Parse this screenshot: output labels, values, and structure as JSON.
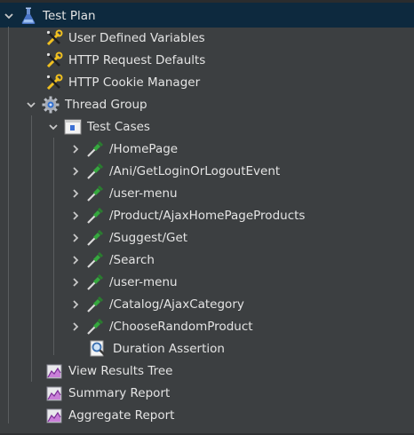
{
  "tree": {
    "root": {
      "label": "Test Plan",
      "icon": "flask-icon",
      "expanded": true,
      "selected": true
    },
    "config_elements": [
      {
        "label": "User Defined Variables",
        "icon": "wrench-screwdriver-icon"
      },
      {
        "label": "HTTP Request Defaults",
        "icon": "wrench-screwdriver-icon"
      },
      {
        "label": "HTTP Cookie Manager",
        "icon": "wrench-screwdriver-icon"
      }
    ],
    "thread_group": {
      "label": "Thread Group",
      "icon": "gear-icon",
      "expanded": true,
      "controller": {
        "label": "Test Cases",
        "icon": "simple-controller-icon",
        "expanded": true,
        "samplers": [
          {
            "label": "/HomePage",
            "icon": "pipette-icon"
          },
          {
            "label": "/Ani/GetLoginOrLogoutEvent",
            "icon": "pipette-icon"
          },
          {
            "label": "/user-menu",
            "icon": "pipette-icon"
          },
          {
            "label": "/Product/AjaxHomePageProducts",
            "icon": "pipette-icon"
          },
          {
            "label": "/Suggest/Get",
            "icon": "pipette-icon"
          },
          {
            "label": "/Search",
            "icon": "pipette-icon"
          },
          {
            "label": "/user-menu",
            "icon": "pipette-icon"
          },
          {
            "label": "/Catalog/AjaxCategory",
            "icon": "pipette-icon"
          },
          {
            "label": "/ChooseRandomProduct",
            "icon": "pipette-icon"
          }
        ],
        "assertion": {
          "label": "Duration Assertion",
          "icon": "magnifier-icon"
        }
      }
    },
    "listeners": [
      {
        "label": "View Results Tree",
        "icon": "report-icon"
      },
      {
        "label": "Summary Report",
        "icon": "report-icon"
      },
      {
        "label": "Aggregate Report",
        "icon": "report-icon"
      }
    ]
  },
  "colors": {
    "background": "#3c3f41",
    "selection": "#0d293e",
    "text": "#e4e4e4",
    "tree_line": "#5a5d5f"
  }
}
